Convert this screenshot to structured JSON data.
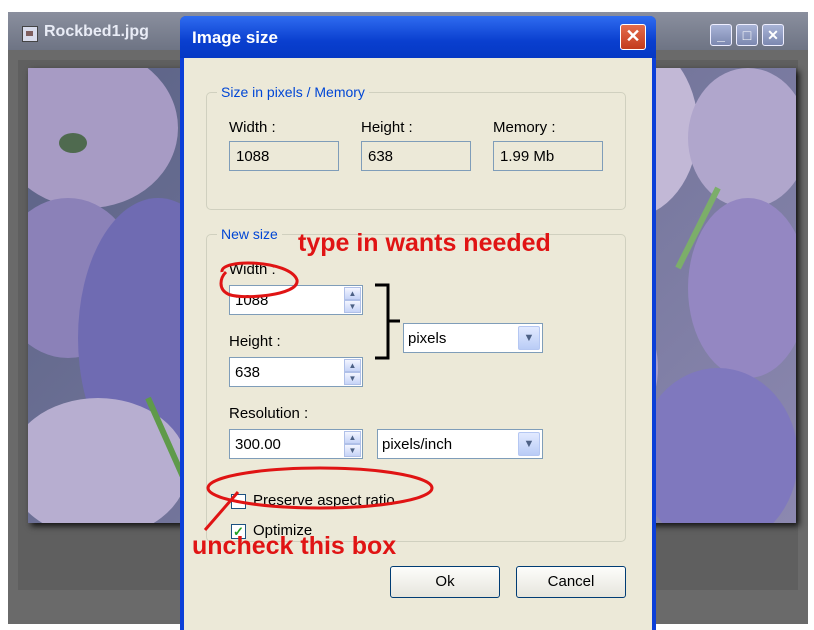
{
  "background_window": {
    "title": "Rockbed1.jpg",
    "buttons": [
      {
        "name": "minimize-button",
        "glyph": "_"
      },
      {
        "name": "maximize-button",
        "glyph": "□"
      },
      {
        "name": "close-button",
        "glyph": "✕"
      }
    ]
  },
  "dialog": {
    "title": "Image size",
    "close_glyph": "✕",
    "pixels_memory": {
      "legend": "Size in pixels / Memory",
      "width_label": "Width :",
      "width_value": "1088",
      "height_label": "Height :",
      "height_value": "638",
      "memory_label": "Memory :",
      "memory_value": "1.99 Mb"
    },
    "new_size": {
      "legend": "New size",
      "width_label": "Width :",
      "width_value": "1088",
      "height_label": "Height :",
      "height_value": "638",
      "unit": "pixels",
      "resolution_label": "Resolution :",
      "resolution_value": "300.00",
      "resolution_unit": "pixels/inch"
    },
    "preserve_aspect_label": "Preserve aspect ratio",
    "preserve_aspect_checked": false,
    "optimize_label": "Optimize",
    "optimize_checked": true,
    "ok_label": "Ok",
    "cancel_label": "Cancel"
  },
  "annotations": {
    "type_in": "type in wants needed",
    "uncheck": "uncheck this box",
    "color": "#e01414"
  }
}
